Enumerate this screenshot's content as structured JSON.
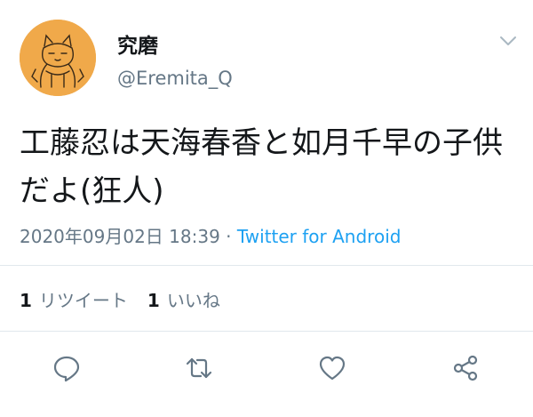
{
  "user": {
    "display_name": "究磨",
    "handle": "@Eremita_Q"
  },
  "tweet": {
    "text": "工藤忍は天海春香と如月千早の子供だよ(狂人)",
    "timestamp": "2020年09月02日 18:39",
    "separator": " · ",
    "source": "Twitter for Android"
  },
  "stats": {
    "retweets_count": "1",
    "retweets_label": "リツイート",
    "likes_count": "1",
    "likes_label": "いいね"
  },
  "icons": {
    "caret": "chevron-down-icon",
    "reply": "reply-icon",
    "retweet": "retweet-icon",
    "like": "heart-icon",
    "share": "share-icon"
  },
  "colors": {
    "text": "#14171a",
    "secondary": "#657786",
    "link": "#1da1f2",
    "divider": "#e1e8ed",
    "avatar_bg": "#f0a94a"
  }
}
